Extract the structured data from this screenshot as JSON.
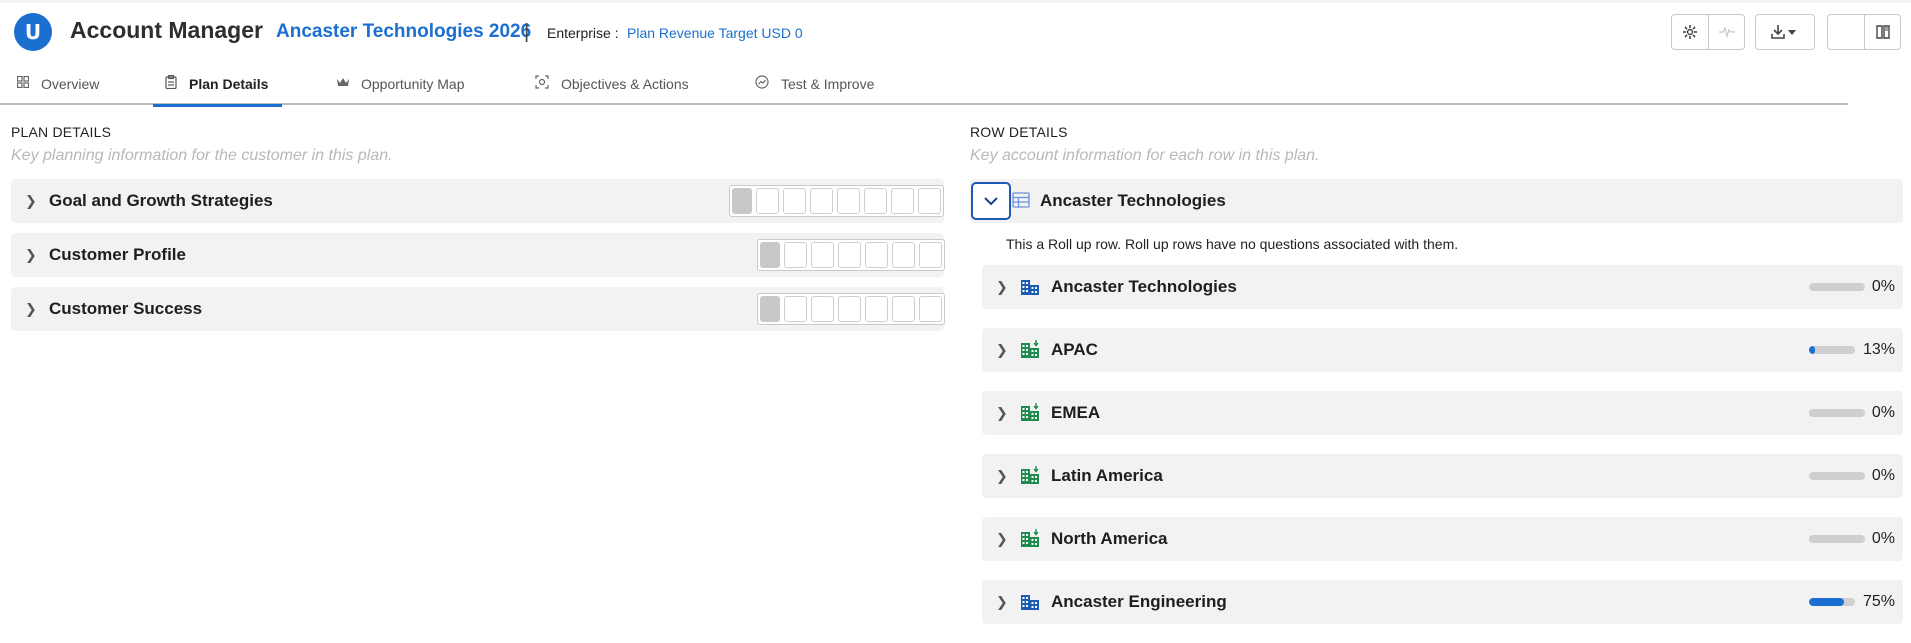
{
  "header": {
    "logo_letter": "U",
    "app_title": "Account Manager",
    "plan_title": "Ancaster Technologies 2026",
    "separator": "|",
    "enterprise_label": "Enterprise :",
    "enterprise_value": "Plan Revenue Target USD 0",
    "toolbar": {
      "settings_icon": "gear-icon",
      "activity_icon": "pulse-icon",
      "download_icon": "download-icon",
      "help_label": "?",
      "book_icon": "book-icon"
    }
  },
  "tabs": [
    {
      "label": "Overview",
      "icon": "grid-icon",
      "active": false
    },
    {
      "label": "Plan Details",
      "icon": "clipboard-icon",
      "active": true
    },
    {
      "label": "Opportunity Map",
      "icon": "crown-icon",
      "active": false
    },
    {
      "label": "Objectives & Actions",
      "icon": "target-icon",
      "active": false
    },
    {
      "label": "Test & Improve",
      "icon": "chart-circle-icon",
      "active": false
    }
  ],
  "plan_details": {
    "title": "PLAN DETAILS",
    "subtitle": "Key planning information for the customer in this plan.",
    "sections": [
      {
        "label": "Goal and Growth Strategies",
        "segments": 7
      },
      {
        "label": "Customer Profile",
        "segments": 6
      },
      {
        "label": "Customer Success",
        "segments": 6
      }
    ]
  },
  "row_details": {
    "title": "ROW DETAILS",
    "subtitle": "Key account information for each row in this plan.",
    "rollup": {
      "label": "Ancaster Technologies",
      "note": "This a Roll up row. Roll up rows have no questions associated with them."
    },
    "rows": [
      {
        "label": "Ancaster Technologies",
        "pct_text": "0%",
        "progress": 0,
        "icon": "building-icon",
        "color": "#1b5ab5"
      },
      {
        "label": "APAC",
        "pct_text": "13%",
        "progress": 0.13,
        "icon": "building-down-icon",
        "color": "#1e8c4e"
      },
      {
        "label": "EMEA",
        "pct_text": "0%",
        "progress": 0,
        "icon": "building-down-icon",
        "color": "#1e8c4e"
      },
      {
        "label": "Latin America",
        "pct_text": "0%",
        "progress": 0,
        "icon": "building-down-icon",
        "color": "#1e8c4e"
      },
      {
        "label": "North America",
        "pct_text": "0%",
        "progress": 0,
        "icon": "building-down-icon",
        "color": "#1e8c4e"
      },
      {
        "label": "Ancaster Engineering",
        "pct_text": "75%",
        "progress": 0.75,
        "icon": "building-icon",
        "color": "#1b5ab5"
      }
    ]
  },
  "colors": {
    "accent": "#1b6fd0",
    "row_bg": "#f2f2f2",
    "progress_track": "#cfcfcf"
  }
}
